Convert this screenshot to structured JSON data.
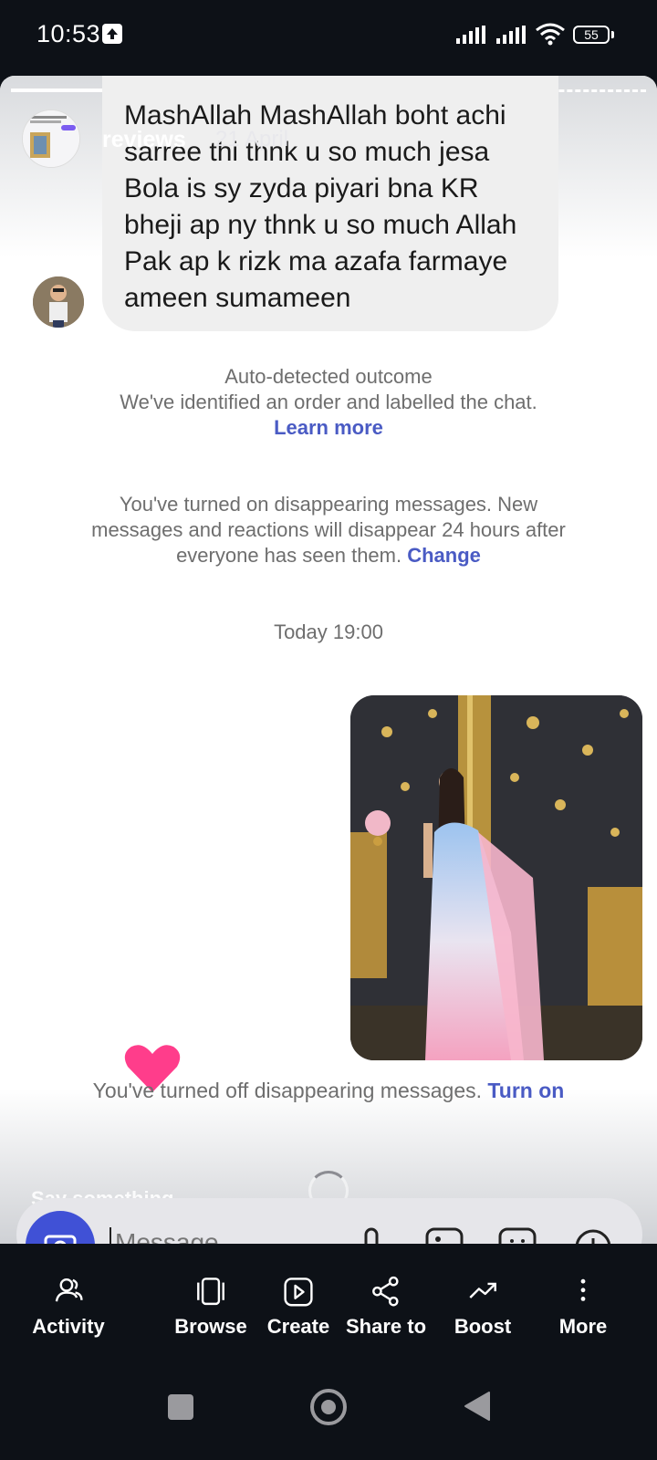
{
  "status_bar": {
    "time": "10:53",
    "battery": "55",
    "icons": [
      "upload-icon",
      "signal-icon",
      "signal-icon",
      "wifi-icon",
      "battery-icon"
    ]
  },
  "story": {
    "username": "reviews",
    "date": "21 April"
  },
  "chat": {
    "message": "MashAllah MashAllah boht achi sarree thi thnk u so much jesa Bola is sy zyda piyari bna KR bheji ap ny thnk u so much Allah Pak ap k rizk ma azafa farmaye ameen sumameen",
    "outcome_title": "Auto-detected outcome",
    "outcome_body": "We've identified an order and labelled the chat.",
    "outcome_link": "Learn more",
    "disappearing_on": "You've turned on disappearing messages. New messages and reactions will disappear 24 hours after everyone has seen them.",
    "disappearing_on_link": "Change",
    "date_separator": "Today 19:00",
    "disappearing_off": "You've turned off disappearing messages.",
    "disappearing_off_link": "Turn on"
  },
  "reply": {
    "say_something": "Say something...",
    "message_placeholder": "Message"
  },
  "actions": [
    {
      "label": "Activity",
      "icon": "activity-icon"
    },
    {
      "label": "Browse",
      "icon": "browse-icon"
    },
    {
      "label": "Create",
      "icon": "create-icon"
    },
    {
      "label": "Share to",
      "icon": "share-icon"
    },
    {
      "label": "Boost",
      "icon": "boost-icon"
    },
    {
      "label": "More",
      "icon": "more-icon"
    }
  ],
  "colors": {
    "accent_link": "#4a5bc4",
    "camera_button": "#4051d6",
    "heart": "#ff3d8b",
    "background_dark": "#0d1117"
  }
}
